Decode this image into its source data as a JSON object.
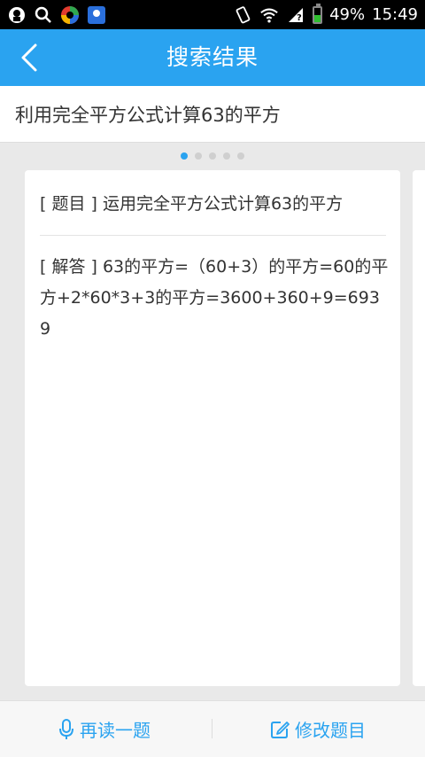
{
  "status_bar": {
    "battery_text": "49%",
    "battery_level": 0.49,
    "time": "15:49",
    "icons": [
      "notification-app-icon",
      "search-icon",
      "browser-icon",
      "baidu-icon",
      "vibrate-icon",
      "wifi-icon",
      "signal-icon",
      "battery-icon"
    ],
    "baidu_label": "du"
  },
  "header": {
    "title": "搜索结果"
  },
  "query": {
    "text": "利用完全平方公式计算63的平方"
  },
  "pager": {
    "count": 5,
    "active_index": 0
  },
  "card": {
    "question": "[ 题目 ] 运用完全平方公式计算63的平方",
    "answer": "[ 解答 ] 63的平方=（60+3）的平方=60的平方+2*60*3+3的平方=3600+360+9=6939"
  },
  "toolbar": {
    "reread_label": "再读一题",
    "edit_label": "修改题目"
  },
  "colors": {
    "accent": "#2aa3f0"
  }
}
